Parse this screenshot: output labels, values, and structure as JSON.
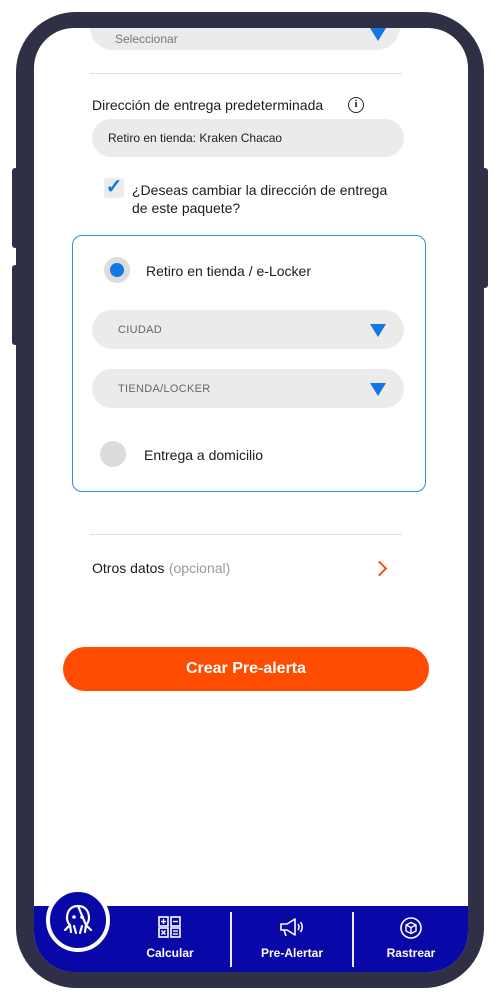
{
  "top_select": {
    "placeholder": "Seleccionar"
  },
  "delivery": {
    "label": "Dirección de entrega predeterminada",
    "value": "Retiro en tienda: Kraken Chacao"
  },
  "change_address": {
    "checked": true,
    "line1": "¿Deseas cambiar la dirección de entrega",
    "line2": "de este paquete?"
  },
  "options": {
    "pickup_label": "Retiro en tienda / e-Locker",
    "city_placeholder": "CIUDAD",
    "store_placeholder": "TIENDA/LOCKER",
    "home_label": "Entrega a domicilio",
    "selected": "pickup"
  },
  "other_data": {
    "label": "Otros datos",
    "hint": "(opcional)"
  },
  "cta_label": "Crear Pre-alerta",
  "nav": {
    "items": [
      {
        "label": "Calcular",
        "icon": "calculator-icon"
      },
      {
        "label": "Pre-Alertar",
        "icon": "megaphone-icon"
      },
      {
        "label": "Rastrear",
        "icon": "package-tracking-icon"
      }
    ],
    "logo": "octopus-logo-icon"
  },
  "colors": {
    "accent_blue": "#1277e1",
    "cta_orange": "#ff4c00",
    "nav_blue": "#0807a8",
    "frame": "#2f2f45"
  }
}
